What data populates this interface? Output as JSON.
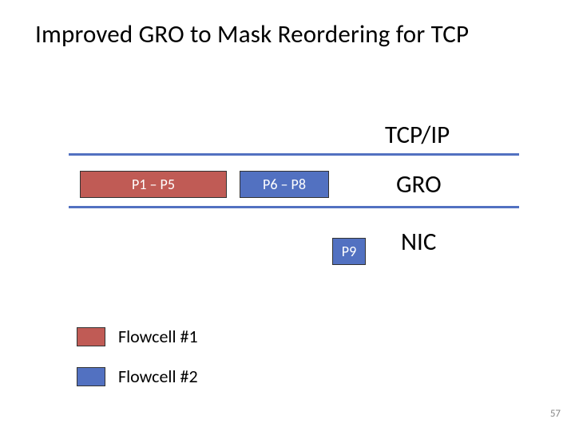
{
  "title": "Improved GRO to Mask Reordering for TCP",
  "layers": {
    "tcpip": "TCP/IP",
    "gro": "GRO",
    "nic": "NIC"
  },
  "packets": {
    "p1_p5": "P1 – P5",
    "p6_p8": "P6 – P8",
    "p9": "P9"
  },
  "legend": {
    "flowcell1": "Flowcell #1",
    "flowcell2": "Flowcell #2"
  },
  "page_number": "57",
  "chart_data": {
    "type": "table",
    "title": "Improved GRO to Mask Reordering for TCP",
    "layers_top_to_bottom": [
      "TCP/IP",
      "GRO",
      "NIC"
    ],
    "flowcells": [
      {
        "name": "Flowcell #1",
        "color": "#c05b55"
      },
      {
        "name": "Flowcell #2",
        "color": "#5271c1"
      }
    ],
    "packet_blocks": [
      {
        "label": "P1 – P5",
        "flowcell": "Flowcell #1",
        "layer": "GRO"
      },
      {
        "label": "P6 – P8",
        "flowcell": "Flowcell #2",
        "layer": "GRO"
      },
      {
        "label": "P9",
        "flowcell": "Flowcell #2",
        "layer": "NIC"
      }
    ]
  }
}
